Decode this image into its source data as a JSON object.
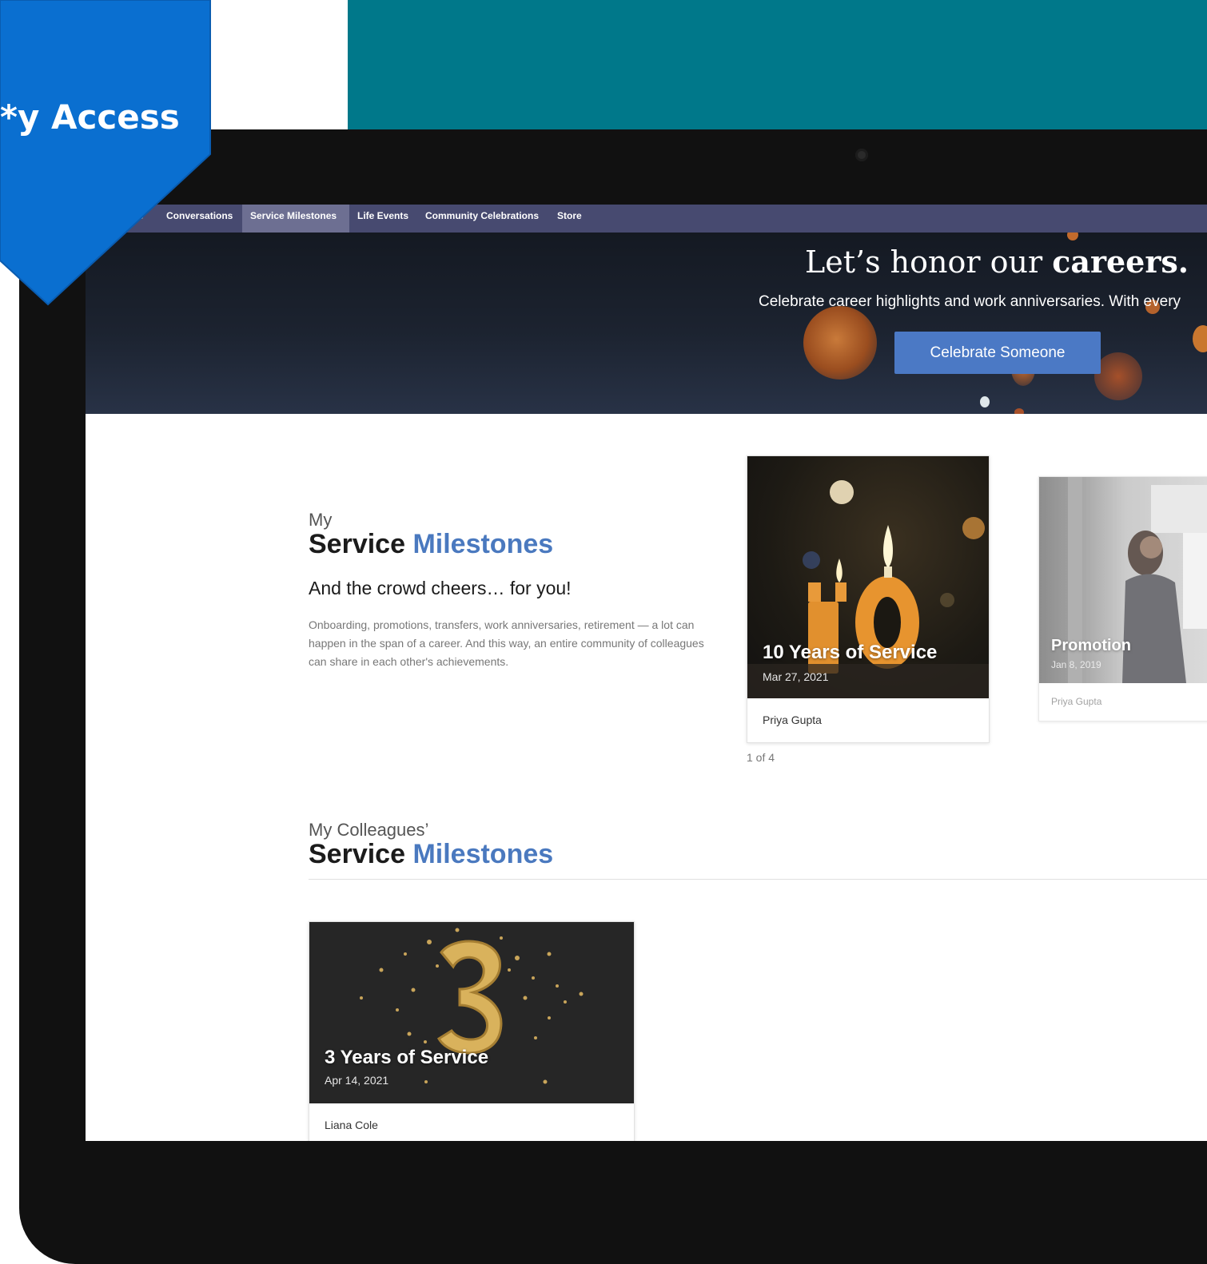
{
  "banner": {
    "text": "y Access*"
  },
  "nav": {
    "items": [
      {
        "label": "es",
        "active": false
      },
      {
        "label": "Conversations",
        "active": false
      },
      {
        "label": "Service Milestones",
        "active": true
      },
      {
        "label": "Life Events",
        "active": false
      },
      {
        "label": "Community Celebrations",
        "active": false
      },
      {
        "label": "Store",
        "active": false
      }
    ]
  },
  "hero": {
    "title_pre": "Let’s honor our ",
    "title_bold": "careers.",
    "subtitle": "Celebrate career highlights and work anniversaries. With every",
    "button": "Celebrate Someone"
  },
  "my_section": {
    "pre": "My",
    "title_dark": "Service",
    "title_blue": "Milestones",
    "tagline": "And the crowd cheers… for you!",
    "description": "Onboarding, promotions, transfers, work anniversaries, retirement — a lot can happen in the span of a career. And this way, an entire community of colleagues can share in each other's achievements.",
    "cards": [
      {
        "title": "10 Years of Service",
        "date": "Mar 27, 2021",
        "name": "Priya Gupta"
      },
      {
        "title": "Promotion",
        "date": "Jan 8, 2019",
        "name": "Priya Gupta"
      }
    ],
    "pager": "1 of 4"
  },
  "colleagues_section": {
    "pre": "My Colleagues’",
    "title_dark": "Service",
    "title_blue": "Milestones",
    "cards": [
      {
        "title": "3 Years of Service",
        "date": "Apr 14, 2021",
        "name": "Liana Cole"
      }
    ]
  },
  "colors": {
    "teal": "#00788a",
    "banner_blue": "#0a6fd0",
    "nav_bg": "#474a70",
    "nav_active": "#6d6f92",
    "accent_blue": "#4a79bf",
    "button_blue": "#4b79c5"
  }
}
